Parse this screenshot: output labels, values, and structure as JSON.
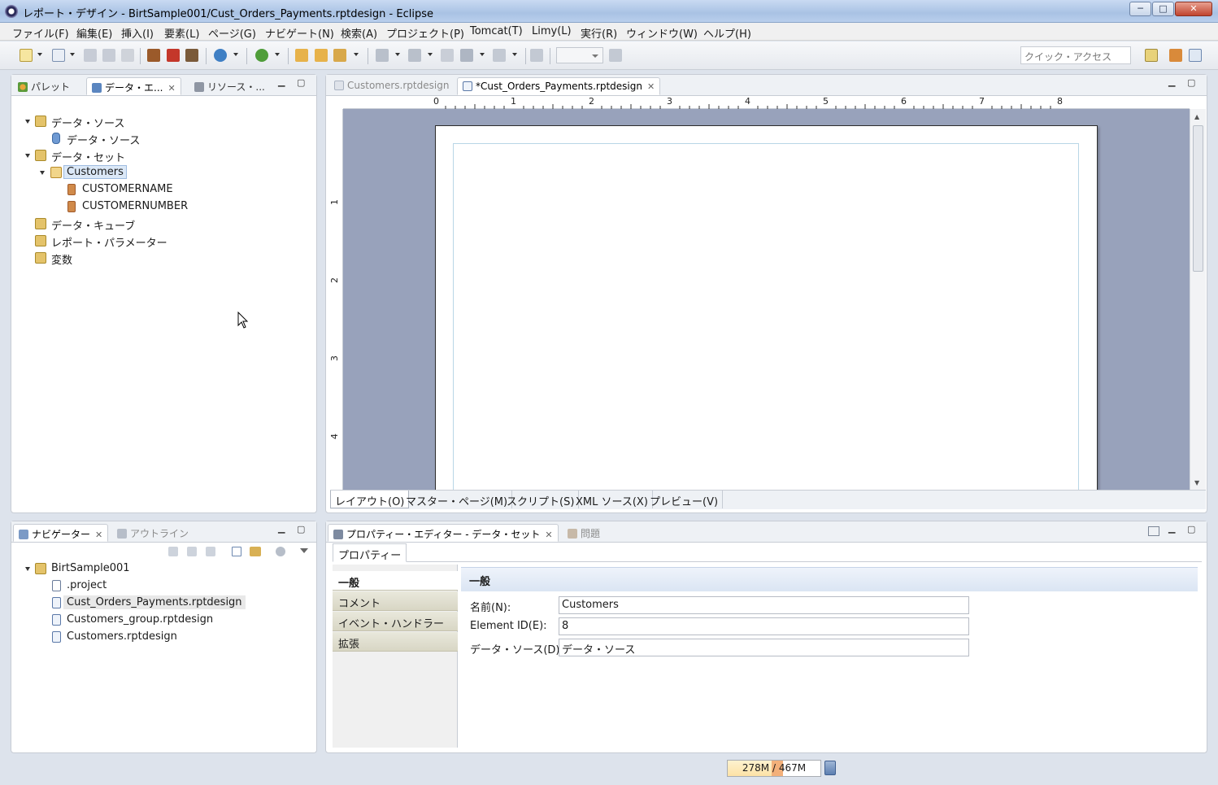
{
  "window": {
    "title": "レポート・デザイン - BirtSample001/Cust_Orders_Payments.rptdesign - Eclipse",
    "controls": [
      "─",
      "□",
      "✕"
    ]
  },
  "menu": [
    "ファイル(F)",
    "編集(E)",
    "挿入(I)",
    "要素(L)",
    "ページ(G)",
    "ナビゲート(N)",
    "検索(A)",
    "プロジェクト(P)",
    "Tomcat(T)",
    "Limy(L)",
    "実行(R)",
    "ウィンドウ(W)",
    "ヘルプ(H)"
  ],
  "toolbar": {
    "quick_access_placeholder": "クイック・アクセス",
    "zoom_value": ""
  },
  "data_explorer": {
    "tabs": [
      {
        "label": "パレット",
        "icon": "palette-icon"
      },
      {
        "label": "データ・エ...",
        "icon": "data-explorer-icon"
      },
      {
        "label": "リソース・...",
        "icon": "resource-icon"
      }
    ],
    "tree": [
      {
        "label": "データ・ソース",
        "icon": "datasource-folder-icon",
        "level": 0,
        "expanded": true
      },
      {
        "label": "データ・ソース",
        "icon": "database-icon",
        "level": 1
      },
      {
        "label": "データ・セット",
        "icon": "dataset-folder-icon",
        "level": 0,
        "expanded": true
      },
      {
        "label": "Customers",
        "icon": "dataset-icon",
        "level": 1,
        "expanded": true,
        "selected": true
      },
      {
        "label": "CUSTOMERNAME",
        "icon": "column-icon",
        "level": 2
      },
      {
        "label": "CUSTOMERNUMBER",
        "icon": "column-icon",
        "level": 2
      },
      {
        "label": "データ・キューブ",
        "icon": "cube-folder-icon",
        "level": 0
      },
      {
        "label": "レポート・パラメーター",
        "icon": "parameter-folder-icon",
        "level": 0
      },
      {
        "label": "変数",
        "icon": "variable-folder-icon",
        "level": 0
      }
    ]
  },
  "navigator": {
    "tabs": [
      {
        "label": "ナビゲーター",
        "icon": "navigator-icon"
      },
      {
        "label": "アウトライン",
        "icon": "outline-icon"
      }
    ],
    "tree": [
      {
        "label": "BirtSample001",
        "icon": "project-icon",
        "level": 0,
        "expanded": true
      },
      {
        "label": ".project",
        "icon": "xml-file-icon",
        "level": 1
      },
      {
        "label": "Cust_Orders_Payments.rptdesign",
        "icon": "report-file-icon",
        "level": 1,
        "selected": true
      },
      {
        "label": "Customers_group.rptdesign",
        "icon": "report-file-icon",
        "level": 1
      },
      {
        "label": "Customers.rptdesign",
        "icon": "report-file-icon",
        "level": 1
      }
    ]
  },
  "editor": {
    "tabs": [
      {
        "label": "Customers.rptdesign",
        "icon": "report-file-icon"
      },
      {
        "label": "*Cust_Orders_Payments.rptdesign",
        "icon": "report-file-icon"
      }
    ],
    "ruler_top": [
      "0",
      "1",
      "2",
      "3",
      "4",
      "5",
      "6",
      "7",
      "8"
    ],
    "ruler_left": [
      "1",
      "2",
      "3",
      "4"
    ],
    "bottom_tabs": [
      "レイアウト(O)",
      "マスター・ページ(M)",
      "スクリプト(S)",
      "XML ソース(X)",
      "プレビュー(V)"
    ]
  },
  "properties": {
    "tabs": [
      {
        "label": "プロパティー・エディター - データ・セット",
        "icon": "property-editor-icon"
      },
      {
        "label": "問題",
        "icon": "problems-icon"
      }
    ],
    "subtab": "プロパティー",
    "categories": [
      "一般",
      "コメント",
      "イベント・ハンドラー",
      "拡張"
    ],
    "section_title": "一般",
    "fields": [
      {
        "label": "名前(N):",
        "value": "Customers"
      },
      {
        "label": "Element ID(E):",
        "value": "8"
      },
      {
        "label": "データ・ソース(D)",
        "value": "データ・ソース"
      }
    ]
  },
  "status": {
    "heap_text": "278M / 467M",
    "heap_used_fraction": 0.595
  },
  "colors": {
    "selection": "#dbe8f7",
    "canvas": "#98a2bb",
    "close_button": "#c0442e"
  }
}
